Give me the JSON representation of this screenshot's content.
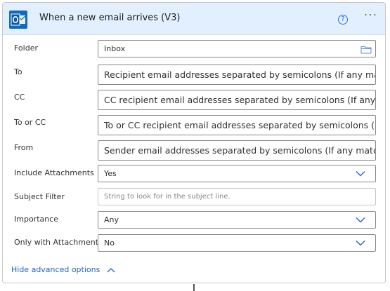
{
  "header": {
    "title": "When a new email arrives (V3)",
    "app_icon": "outlook-icon",
    "help_glyph": "?",
    "more_glyph": "···"
  },
  "fields": [
    {
      "label": "Folder",
      "value": "Inbox",
      "kind": "folder"
    },
    {
      "label": "To",
      "value": "Recipient email addresses separated by semicolons (If any match, the",
      "kind": "text"
    },
    {
      "label": "CC",
      "value": "CC recipient email addresses separated by semicolons (If any match, t",
      "kind": "text"
    },
    {
      "label": "To or CC",
      "value": "To or CC recipient email addresses separated by semicolons (If any m",
      "kind": "text"
    },
    {
      "label": "From",
      "value": "Sender email addresses separated by semicolons (If any match, the tr",
      "kind": "text"
    },
    {
      "label": "Include Attachments",
      "value": "Yes",
      "kind": "dropdown"
    },
    {
      "label": "Subject Filter",
      "placeholder": "String to look for in the subject line.",
      "kind": "input"
    },
    {
      "label": "Importance",
      "value": "Any",
      "kind": "dropdown"
    },
    {
      "label": "Only with Attachments",
      "value": "No",
      "kind": "dropdown"
    }
  ],
  "footer": {
    "advanced_toggle": "Hide advanced options"
  },
  "colors": {
    "header_bg": "#e1efff",
    "accent": "#2266c4",
    "border": "#8a8886"
  }
}
